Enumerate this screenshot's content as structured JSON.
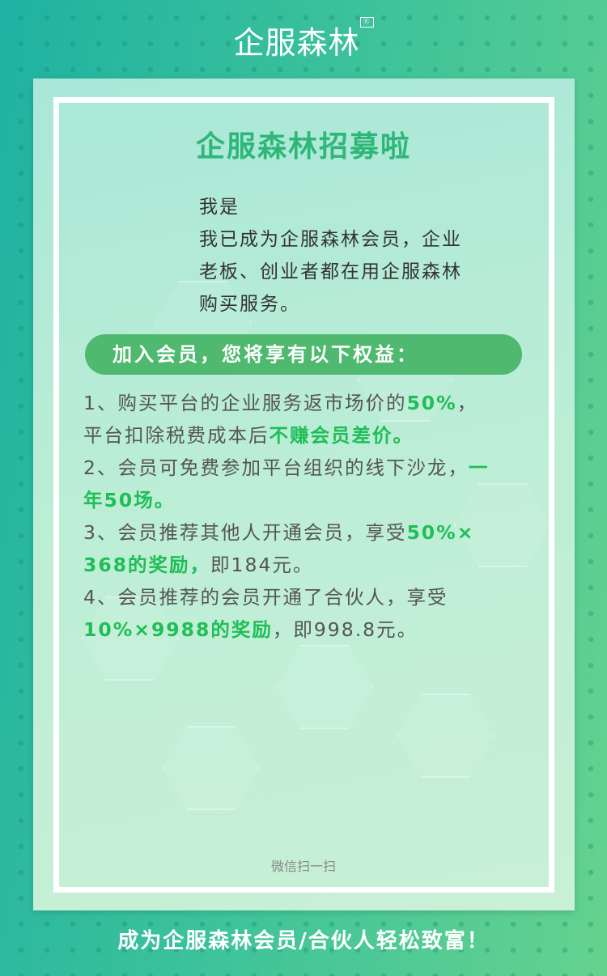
{
  "logo": {
    "text": "企服森林",
    "mark": "®"
  },
  "title": "企服森林招募啦",
  "intro": [
    "我是",
    "我已成为企服森林会员，企业",
    "老板、创业者都在用企服森林",
    "购买服务。"
  ],
  "pill": "加入会员，您将享有以下权益：",
  "items": [
    [
      {
        "t": "1、购买平台的企业服务返市场价的",
        "g": false
      },
      {
        "t": "50%",
        "g": true
      },
      {
        "t": "，",
        "g": false
      },
      {
        "br": true
      },
      {
        "t": "平台扣除税费成本后",
        "g": false
      },
      {
        "t": "不赚会员差价。",
        "g": true
      }
    ],
    [
      {
        "t": "2、会员可免费参加平台组织的线下沙龙，",
        "g": false
      },
      {
        "t": "一",
        "g": true
      },
      {
        "br": true
      },
      {
        "t": "年50场。",
        "g": true
      }
    ],
    [
      {
        "t": "3、会员推荐其他人开通会员，享受",
        "g": false
      },
      {
        "t": "50%×",
        "g": true
      },
      {
        "br": true
      },
      {
        "t": "368的奖励，",
        "g": true
      },
      {
        "t": "即184元。",
        "g": false
      }
    ],
    [
      {
        "t": "4、会员推荐的会员开通了合伙人，享受",
        "g": false
      },
      {
        "br": true
      },
      {
        "t": "10%×9988的奖励",
        "g": true
      },
      {
        "t": "，即998.8元。",
        "g": false
      }
    ]
  ],
  "scan_label": "微信扫一扫",
  "footer": "成为企服森林会员/合伙人轻松致富！",
  "colors": {
    "accent": "#1fbe57",
    "pill": "#4fb96f",
    "title": "#2fb77a"
  }
}
